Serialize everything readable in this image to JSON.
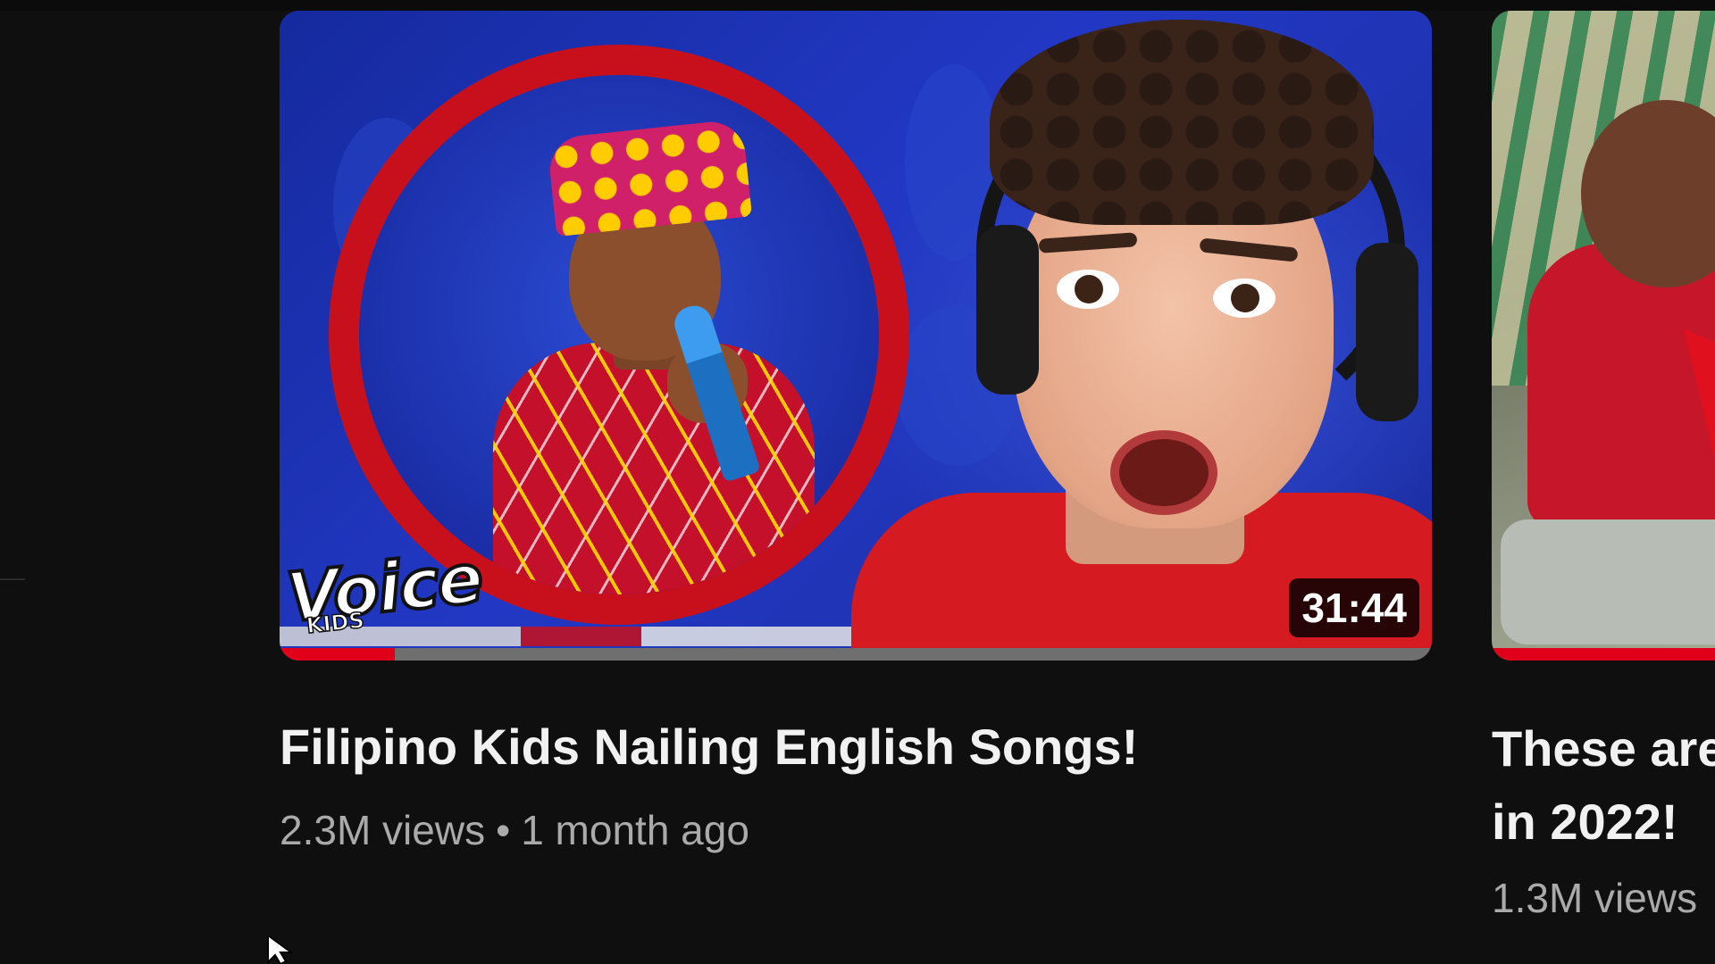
{
  "videos": [
    {
      "thumbnail_logo": "the Voice Kids",
      "thumbnail_logo_main": "Voice",
      "thumbnail_logo_sub": "KIDS",
      "duration": "31:44",
      "watch_progress": 0.1,
      "title": "Filipino Kids Nailing English Songs!",
      "views": "2.3M views",
      "separator": "•",
      "age": "1 month ago"
    },
    {
      "title_line1": "These are",
      "title_line2": "in 2022!",
      "views": "1.3M views",
      "watch_progress": 1.0
    }
  ],
  "colors": {
    "background": "#0f0f0f",
    "title_text": "#f1f1f1",
    "meta_text": "#aaaaaa",
    "progress_red": "#e1001a",
    "ring_red": "#c8101c"
  },
  "icons": [
    "mouse-cursor-icon"
  ]
}
